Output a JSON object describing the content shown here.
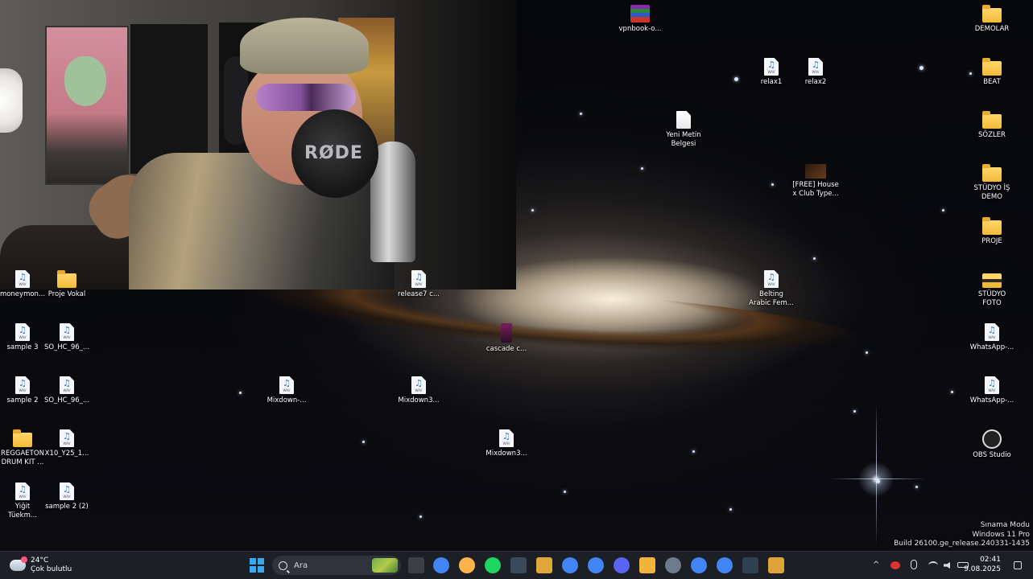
{
  "desktop": {
    "icons": [
      {
        "label": "vpnbook-o...",
        "type": "rar"
      },
      {
        "label": "DEMOLAR",
        "type": "folder"
      },
      {
        "label": "relax1",
        "type": "wav"
      },
      {
        "label": "relax2",
        "type": "wav"
      },
      {
        "label": "BEAT",
        "type": "folder"
      },
      {
        "label": "Yeni Metin\nBelgesi",
        "type": "txt"
      },
      {
        "label": "SÖZLER",
        "type": "folder"
      },
      {
        "label": "[FREE] House\nx Club Type...",
        "type": "video"
      },
      {
        "label": "STÜDYO İŞ\nDEMO",
        "type": "folder"
      },
      {
        "label": "PROJE",
        "type": "folder"
      },
      {
        "label": "Belting\nArabic Fem...",
        "type": "wav"
      },
      {
        "label": "STÜDYO\nFOTO",
        "type": "folder-photo"
      },
      {
        "label": "moneymon...",
        "type": "wav"
      },
      {
        "label": "Proje Vokal",
        "type": "folder"
      },
      {
        "label": "release7 c...",
        "type": "wav"
      },
      {
        "label": "sample 3",
        "type": "wav"
      },
      {
        "label": "SO_HC_96_...",
        "type": "wav"
      },
      {
        "label": "cascade c...",
        "type": "mp4"
      },
      {
        "label": "WhatsApp-...",
        "type": "wav"
      },
      {
        "label": "sample 2",
        "type": "wav"
      },
      {
        "label": "SO_HC_96_...",
        "type": "wav"
      },
      {
        "label": "Mixdown-...",
        "type": "wav"
      },
      {
        "label": "Mixdown3...",
        "type": "wav"
      },
      {
        "label": "WhatsApp-...",
        "type": "wav"
      },
      {
        "label": "REGGAETON\nDRUM KIT ...",
        "type": "folder"
      },
      {
        "label": "X10_Y25_1...",
        "type": "wav"
      },
      {
        "label": "Mixdown3...",
        "type": "wav"
      },
      {
        "label": "OBS Studio",
        "type": "obs"
      },
      {
        "label": "Yiğit\nTüekm...",
        "type": "wav"
      },
      {
        "label": "sample 2 (2)",
        "type": "wav"
      }
    ],
    "wav_badge": "WAV"
  },
  "webcam": {
    "mic_brand": "RØDE"
  },
  "watermark": {
    "line1": "Sınama Modu",
    "line2": "Windows 11 Pro",
    "line3": "Build 26100.ge_release.240331-1435"
  },
  "taskbar": {
    "weather_temp": "24°C",
    "weather_desc": "Çok bulutlu",
    "search_placeholder": "Ara",
    "apps": [
      "file-explorer-app",
      "chrome-app",
      "copilot-app",
      "spotify-app",
      "terminal-app",
      "file-app",
      "chrome-app-2",
      "chrome-app-3",
      "discord-app",
      "folder-app",
      "obs-app",
      "chrome-app-4",
      "chrome-app-5",
      "terminal-app-2",
      "media-app"
    ],
    "tray_chevron": "^",
    "time": "02:41",
    "date": "9.08.2025"
  },
  "colors": {
    "taskbar_bg": "#1c1f26",
    "folder": "#f1b93a",
    "start_blue": "#3ba7f0"
  }
}
